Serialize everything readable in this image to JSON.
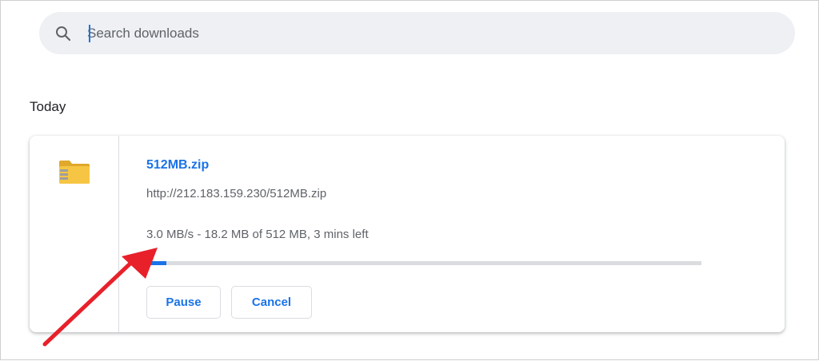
{
  "search": {
    "placeholder": "Search downloads",
    "value": ""
  },
  "section": {
    "title": "Today"
  },
  "download": {
    "file_name": "512MB.zip",
    "url": "http://212.183.159.230/512MB.zip",
    "status": "3.0 MB/s - 18.2 MB of 512 MB, 3 mins left",
    "progress_fraction": 0.0355,
    "pause_label": "Pause",
    "cancel_label": "Cancel"
  },
  "colors": {
    "accent": "#1a73e8",
    "search_bg": "#eef0f3",
    "annotation": "#e8202a",
    "folder": "#f6c544"
  },
  "icons": {
    "search": "search-icon",
    "file": "zip-folder-icon"
  }
}
